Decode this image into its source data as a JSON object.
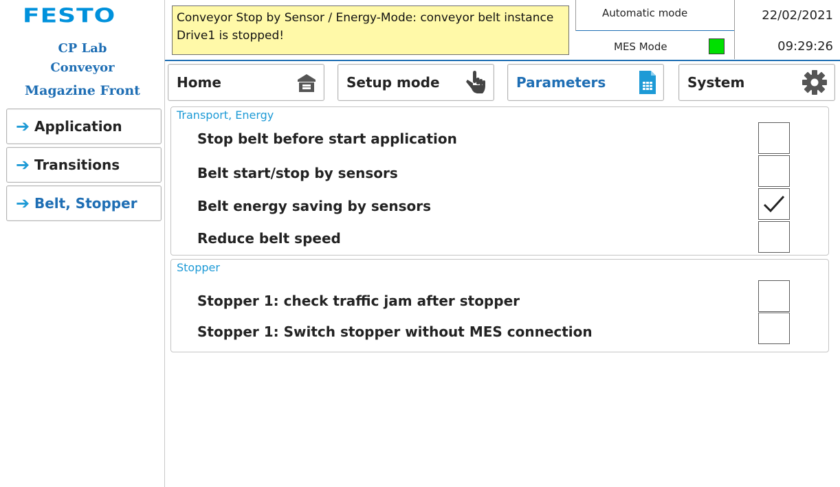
{
  "header": {
    "logo": "FESTO",
    "station_lines": [
      "CP Lab",
      "Conveyor",
      "Magazine Front"
    ],
    "message": "Conveyor Stop by Sensor / Energy-Mode: conveyor belt instance Drive1 is stopped!",
    "automatic_mode_label": "Automatic mode",
    "mes_mode_label": "MES Mode",
    "mes_led_color": "#00e000",
    "date": "22/02/2021",
    "time": "09:29:26"
  },
  "tabs": [
    {
      "label": "Home",
      "icon": "garage-icon",
      "active": false
    },
    {
      "label": "Setup mode",
      "icon": "hand-pointer-icon",
      "active": false
    },
    {
      "label": "Parameters",
      "icon": "document-table-icon",
      "active": true
    },
    {
      "label": "System",
      "icon": "gear-icon",
      "active": false
    }
  ],
  "sidebar": {
    "items": [
      {
        "label": "Application",
        "icon": "arrow-right-icon",
        "active": false
      },
      {
        "label": "Transitions",
        "icon": "arrow-right-icon",
        "active": false
      },
      {
        "label": "Belt, Stopper",
        "icon": "arrow-right-icon",
        "active": true
      }
    ]
  },
  "sections": [
    {
      "title": "Transport, Energy",
      "rows": [
        {
          "label": "Stop belt before start application",
          "checked": false
        },
        {
          "label": "Belt start/stop by sensors",
          "checked": false
        },
        {
          "label": "Belt energy saving by sensors",
          "checked": true
        },
        {
          "label": "Reduce belt speed",
          "checked": false
        }
      ]
    },
    {
      "title": "Stopper",
      "rows": [
        {
          "label": "Stopper 1: check traffic jam after stopper",
          "checked": false
        },
        {
          "label": "Stopper 1: Switch stopper without MES connection",
          "checked": false
        }
      ]
    }
  ],
  "colors": {
    "accent": "#1e6eb4",
    "brand": "#0091dc",
    "message_bg": "#fff9a8"
  }
}
